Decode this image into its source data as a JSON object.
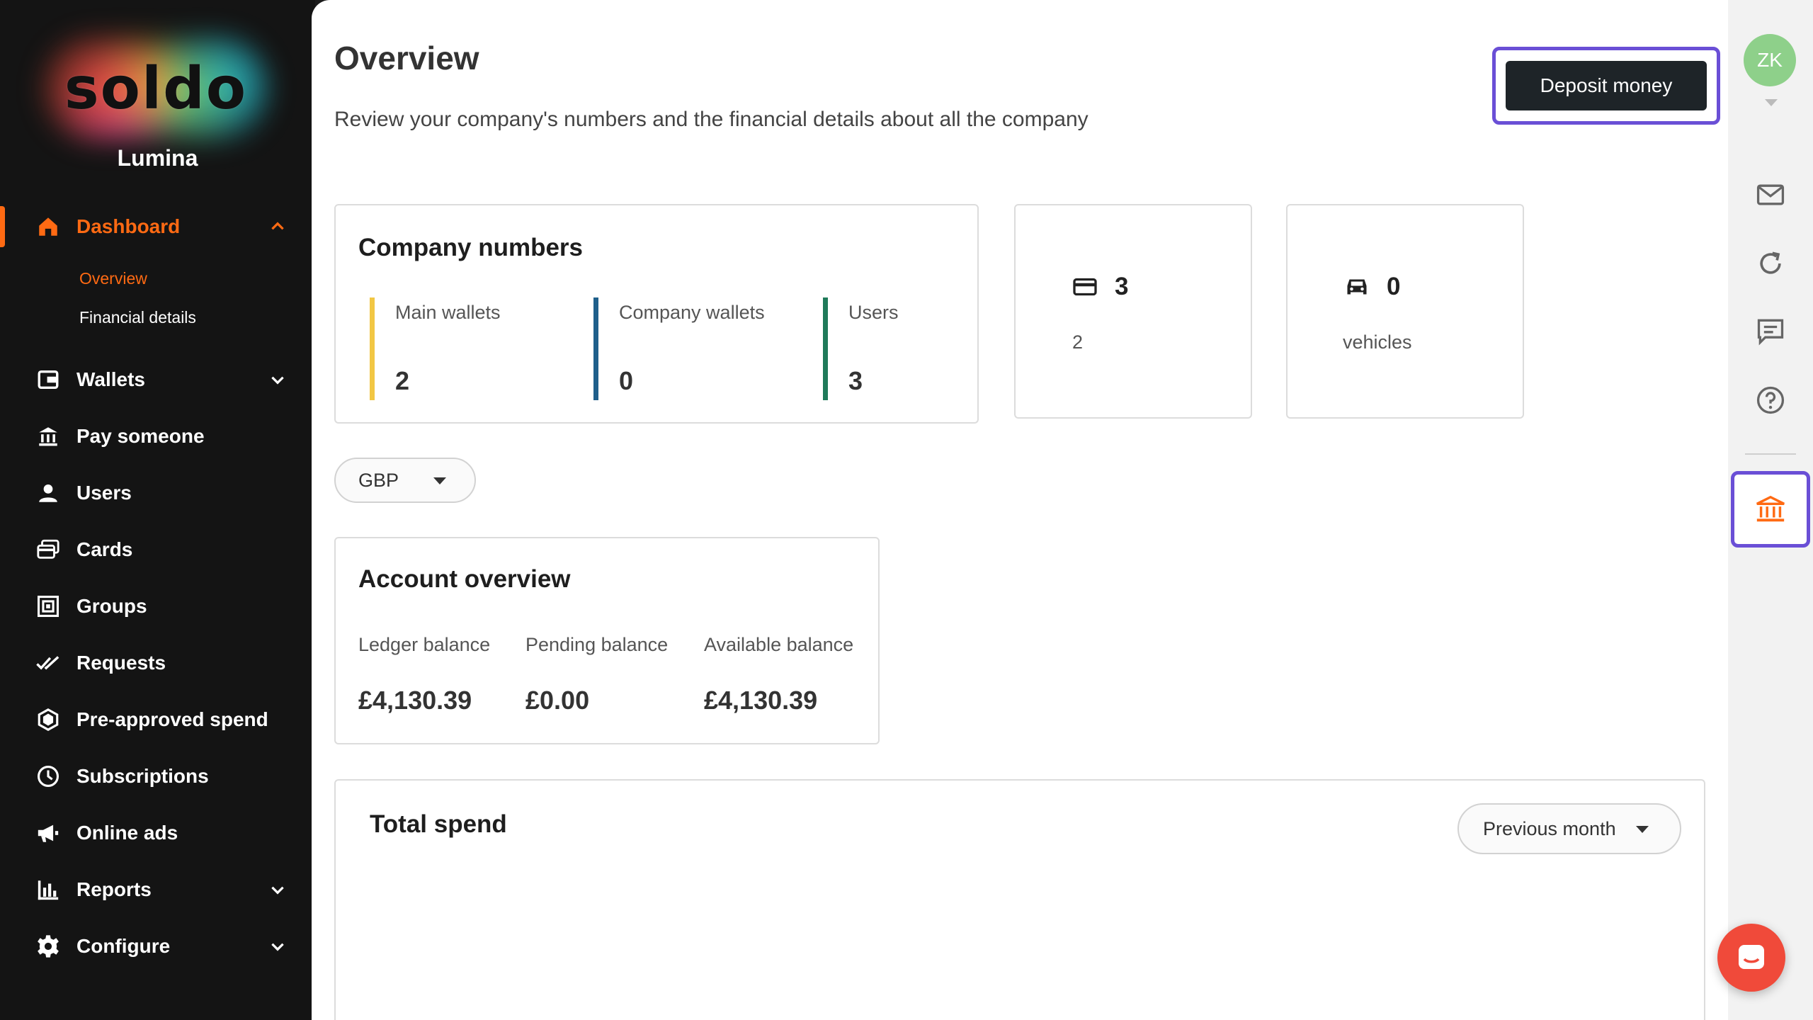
{
  "brand": {
    "logo_text": "soldo",
    "org_name": "Lumina",
    "accent": "#ff6a13"
  },
  "nav": {
    "dashboard": "Dashboard",
    "overview": "Overview",
    "financial_details": "Financial details",
    "wallets": "Wallets",
    "pay_someone": "Pay someone",
    "users": "Users",
    "cards": "Cards",
    "groups": "Groups",
    "requests": "Requests",
    "pre_approved": "Pre-approved spend",
    "subscriptions": "Subscriptions",
    "online_ads": "Online ads",
    "reports": "Reports",
    "configure": "Configure"
  },
  "header": {
    "title": "Overview",
    "subtitle": "Review your company's numbers and the financial details about all the company",
    "deposit_label": "Deposit money"
  },
  "company_numbers": {
    "title": "Company numbers",
    "metrics": [
      {
        "label": "Main wallets",
        "value": "2",
        "color": "#f2c744"
      },
      {
        "label": "Company wallets",
        "value": "0",
        "color": "#1f5f8b"
      },
      {
        "label": "Users",
        "value": "3",
        "color": "#1f7a5a"
      }
    ]
  },
  "cards_stat": {
    "icon": "credit-card-icon",
    "value": "3",
    "caption": "2"
  },
  "vehicles_stat": {
    "icon": "car-icon",
    "value": "0",
    "caption": "vehicles"
  },
  "currency": {
    "selected": "GBP"
  },
  "account_overview": {
    "title": "Account overview",
    "ledger_label": "Ledger balance",
    "ledger_value": "£4,130.39",
    "pending_label": "Pending balance",
    "pending_value": "£0.00",
    "available_label": "Available balance",
    "available_value": "£4,130.39"
  },
  "total_spend": {
    "title": "Total spend",
    "period": "Previous month"
  },
  "user": {
    "initials": "ZK"
  }
}
